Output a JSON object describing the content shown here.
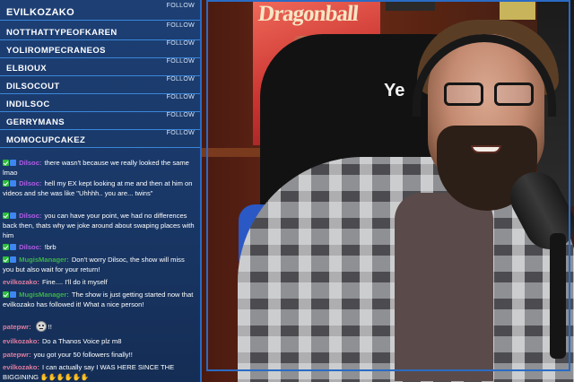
{
  "followers": [
    {
      "name": "EVILKOZAKO",
      "button": "FOLLOW"
    },
    {
      "name": "NOTTHATTYPEOFKAREN",
      "button": "FOLLOW"
    },
    {
      "name": "YOLIROMPECRANEOS",
      "button": "FOLLOW"
    },
    {
      "name": "ELBIOUX",
      "button": "FOLLOW"
    },
    {
      "name": "DILSOCOUT",
      "button": "FOLLOW"
    },
    {
      "name": "INDILSOC",
      "button": "FOLLOW"
    },
    {
      "name": "GERRYMANS",
      "button": "FOLLOW"
    },
    {
      "name": "MOMOCUPCAKEZ",
      "button": "FOLLOW"
    }
  ],
  "chat": [
    {
      "user": "Dilsoc:",
      "text": "there wasn't because we really looked the same lmao"
    },
    {
      "user": "Dilsoc:",
      "text": "hell my EX kept looking at me and then at him on videos and she was like \"Uhhhh.. you are... twins\""
    },
    {
      "user": "Dilsoc:",
      "text": "you can have your point, we had no differences back then, thats why we joke around about swaping places with him"
    },
    {
      "user": "Dilsoc:",
      "text": "!brb"
    },
    {
      "user": "MugisManager:",
      "text": "Don't worry Dilsoc, the show will miss you but also wait for your return!"
    },
    {
      "user": "evilkozako:",
      "text": "Fine.... I'll do it myself"
    },
    {
      "user": "MugisManager:",
      "text": "The show is just getting started now that evilkozako has followed it! What a nice person!"
    },
    {
      "user": "patepwr:",
      "text": "!!"
    },
    {
      "user": "evilkozako:",
      "text": "Do a Thanos Voice plz m8"
    },
    {
      "user": "patepwr:",
      "text": "you got your 50 followers finally!!"
    },
    {
      "user": "evilkozako:",
      "text": "I can actually say I WAS HERE SINCE THE BIGGINING"
    }
  ],
  "scene": {
    "comic_title": "Dragonball",
    "chair_text": "Ye"
  },
  "colors": {
    "overlay_bg": "#1d3f74",
    "divider": "#3a86da",
    "user_dilsoc": "#b05be6",
    "user_mugismanager": "#3cb34a",
    "user_other": "#e07ea0"
  }
}
